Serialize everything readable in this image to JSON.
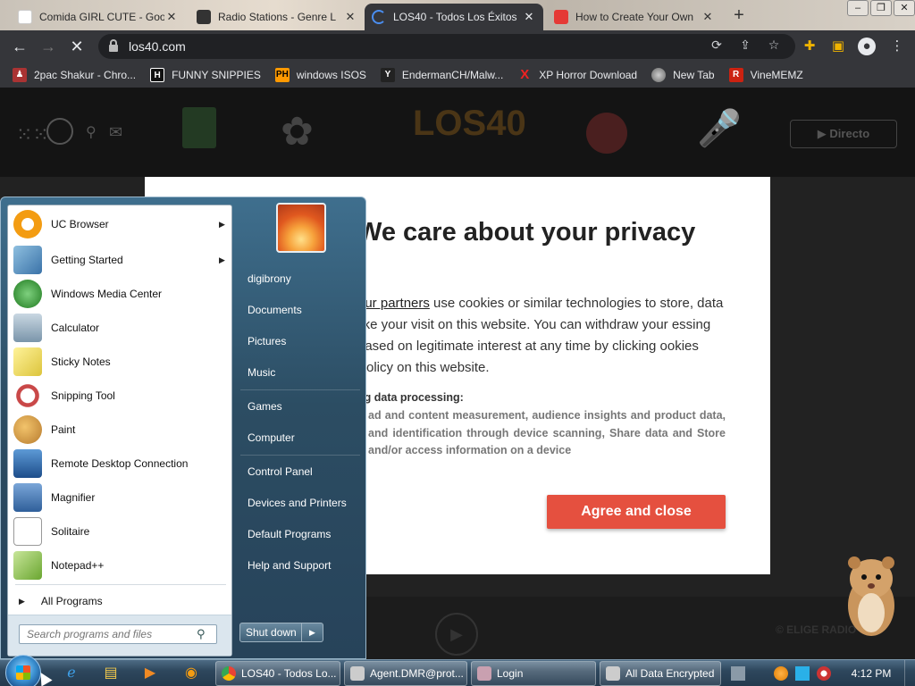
{
  "browser": {
    "tabs": [
      {
        "title": "Comida GIRL CUTE - Goo",
        "favicon_color": "#e8e8e8"
      },
      {
        "title": "Radio Stations - Genre L",
        "favicon_color": "#333333"
      },
      {
        "title": "LOS40 - Todos Los Éxitos",
        "favicon_color": "#2d6cdf"
      },
      {
        "title": "How to Create Your Own",
        "favicon_color": "#e53935"
      }
    ],
    "new_tab_label": "+",
    "url": "los40.com",
    "bookmarks": [
      {
        "label": "2pac Shakur - Chro...",
        "icon": "2pac-icon",
        "color": "#a33"
      },
      {
        "label": "FUNNY SNIPPIES",
        "icon": "H",
        "color": "#111"
      },
      {
        "label": "windows ISOS",
        "icon": "PH",
        "color": "#f90"
      },
      {
        "label": "EndermanCH/Malw...",
        "icon": "YP",
        "color": "#222"
      },
      {
        "label": "XP Horror Download",
        "icon": "X",
        "color": "#c00"
      },
      {
        "label": "New Tab",
        "icon": "globe-icon",
        "color": "#888"
      },
      {
        "label": "VineMEMZ",
        "icon": "R",
        "color": "#c21"
      }
    ]
  },
  "site": {
    "directo_label": "▶ Directo",
    "logo_text": "LOS40",
    "elige_label": "© ELIGE RADIO"
  },
  "consent": {
    "title": "We care about your privacy",
    "body_link": "our partners",
    "body_rest": " use cookies or similar technologies to store, data like your visit on this website. You can withdraw your essing based on legitimate interest at any time by clicking ookies Policy on this website.",
    "subheading": "ng data processing:",
    "purposes": "ad and content measurement, audience insights and product data, and identification through device scanning, Share data and Store and/or access information on a device",
    "agree_label": "Agree and close"
  },
  "start_menu": {
    "programs": [
      {
        "label": "UC Browser",
        "icon": "uc-browser-icon",
        "has_submenu": true,
        "color": "#f39c12"
      },
      {
        "label": "Getting Started",
        "icon": "getting-started-icon",
        "has_submenu": true,
        "color": "#4a90c8"
      },
      {
        "label": "Windows Media Center",
        "icon": "media-center-icon",
        "has_submenu": false,
        "color": "#3c9b3c"
      },
      {
        "label": "Calculator",
        "icon": "calculator-icon",
        "has_submenu": false,
        "color": "#6c8ea8"
      },
      {
        "label": "Sticky Notes",
        "icon": "sticky-notes-icon",
        "has_submenu": false,
        "color": "#e6d34a"
      },
      {
        "label": "Snipping Tool",
        "icon": "snipping-tool-icon",
        "has_submenu": false,
        "color": "#c85050"
      },
      {
        "label": "Paint",
        "icon": "paint-icon",
        "has_submenu": false,
        "color": "#d8a048"
      },
      {
        "label": "Remote Desktop Connection",
        "icon": "remote-desktop-icon",
        "has_submenu": false,
        "color": "#2d6aa8"
      },
      {
        "label": "Magnifier",
        "icon": "magnifier-icon",
        "has_submenu": false,
        "color": "#4a7cb8"
      },
      {
        "label": "Solitaire",
        "icon": "solitaire-icon",
        "has_submenu": false,
        "color": "#ddd"
      },
      {
        "label": "Notepad++",
        "icon": "notepadpp-icon",
        "has_submenu": false,
        "color": "#8fbf4a"
      }
    ],
    "all_programs_label": "All Programs",
    "search_placeholder": "Search programs and files",
    "user_name": "digibrony",
    "right_items": [
      "Documents",
      "Pictures",
      "Music",
      "Games",
      "Computer",
      "Control Panel",
      "Devices and Printers",
      "Default Programs",
      "Help and Support"
    ],
    "shutdown_label": "Shut down"
  },
  "taskbar": {
    "buttons": [
      {
        "label": "LOS40 - Todos Lo...",
        "color": "#2d6cdf"
      },
      {
        "label": "Agent.DMR@prot...",
        "color": "#aaa"
      },
      {
        "label": "Login",
        "color": "#c9a"
      },
      {
        "label": "All Data Encrypted",
        "color": "#aaa"
      }
    ],
    "clock": "4:12 PM"
  }
}
